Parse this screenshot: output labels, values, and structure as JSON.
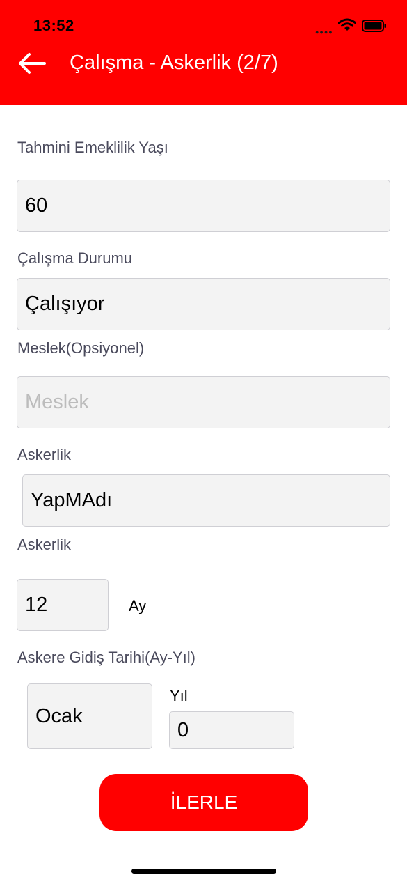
{
  "status_bar": {
    "time": "13:52",
    "signal_icon": "signal-dots-icon",
    "wifi_icon": "wifi-icon",
    "battery_icon": "battery-icon"
  },
  "header": {
    "back_icon": "arrow-left-icon",
    "title": "Çalışma - Askerlik (2/7)",
    "background": "#ff0000"
  },
  "form": {
    "retirement_age": {
      "label": "Tahmini Emeklilik Yaşı",
      "value": "60"
    },
    "work_status": {
      "label": "Çalışma Durumu",
      "value": "Çalışıyor"
    },
    "profession": {
      "label": "Meslek(Opsiyonel)",
      "placeholder": "Meslek"
    },
    "military": {
      "label": "Askerlik",
      "value": "YapMAdı"
    },
    "military_duration": {
      "label": "Askerlik",
      "value": "12",
      "unit": "Ay"
    },
    "military_start": {
      "label": "Askere Gidiş Tarihi(Ay-Yıl)",
      "month": "Ocak",
      "year_label": "Yıl",
      "year_value": "0"
    }
  },
  "actions": {
    "next_label": "İLERLE"
  }
}
